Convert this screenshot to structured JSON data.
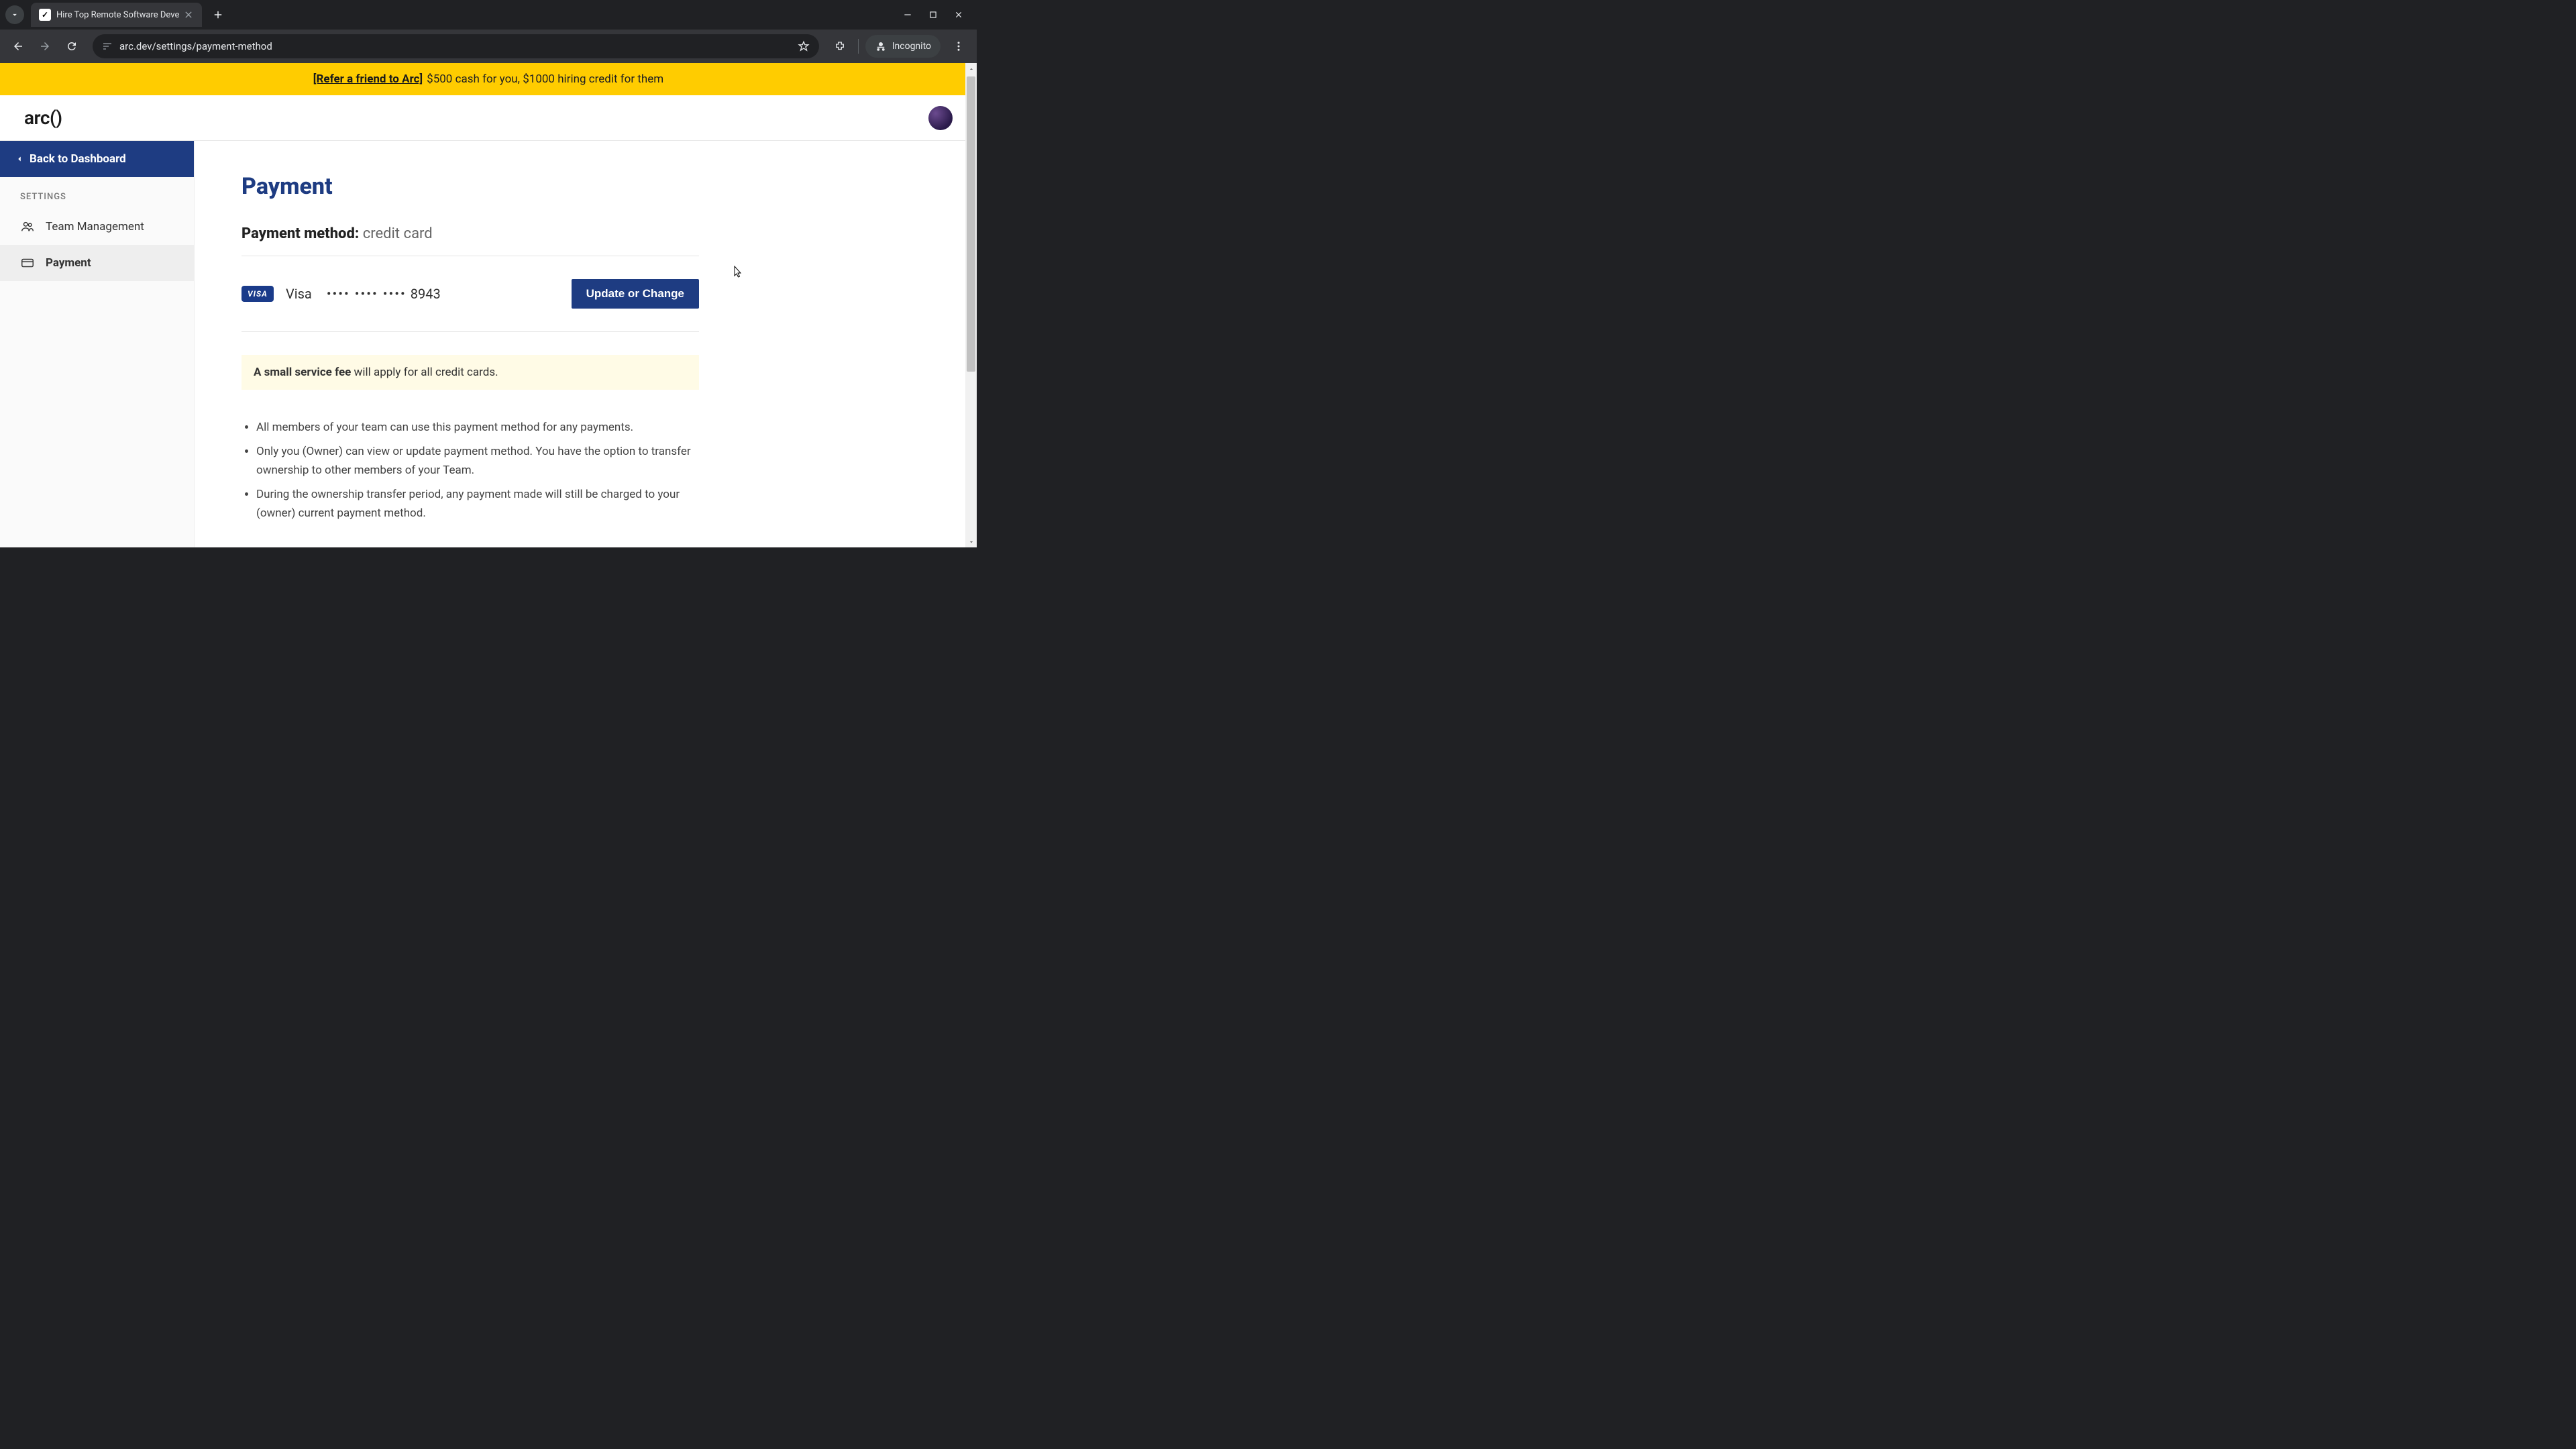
{
  "browser": {
    "tab_title": "Hire Top Remote Software Deve",
    "url": "arc.dev/settings/payment-method",
    "incognito_label": "Incognito"
  },
  "banner": {
    "link_text": "[Refer a friend to Arc]",
    "rest_text": "$500 cash for you, $1000 hiring credit for them"
  },
  "header": {
    "logo": "arc()"
  },
  "sidebar": {
    "back_label": "Back to Dashboard",
    "section_label": "SETTINGS",
    "items": [
      {
        "label": "Team Management"
      },
      {
        "label": "Payment"
      }
    ]
  },
  "main": {
    "title": "Payment",
    "pm_label": "Payment method:",
    "pm_type": "credit card",
    "card": {
      "brand_badge": "VISA",
      "brand": "Visa",
      "mask": "•••• •••• ••••",
      "last4": "8943",
      "update_label": "Update or Change"
    },
    "fee_note_strong": "A small service fee",
    "fee_note_rest": " will apply for all credit cards.",
    "bullets": [
      "All members of your team can use this payment method for any payments.",
      "Only you (Owner) can view or update payment method. You have the option to transfer ownership to other members of your Team.",
      "During the ownership transfer period, any payment made will still be charged to your (owner) current payment method."
    ]
  }
}
